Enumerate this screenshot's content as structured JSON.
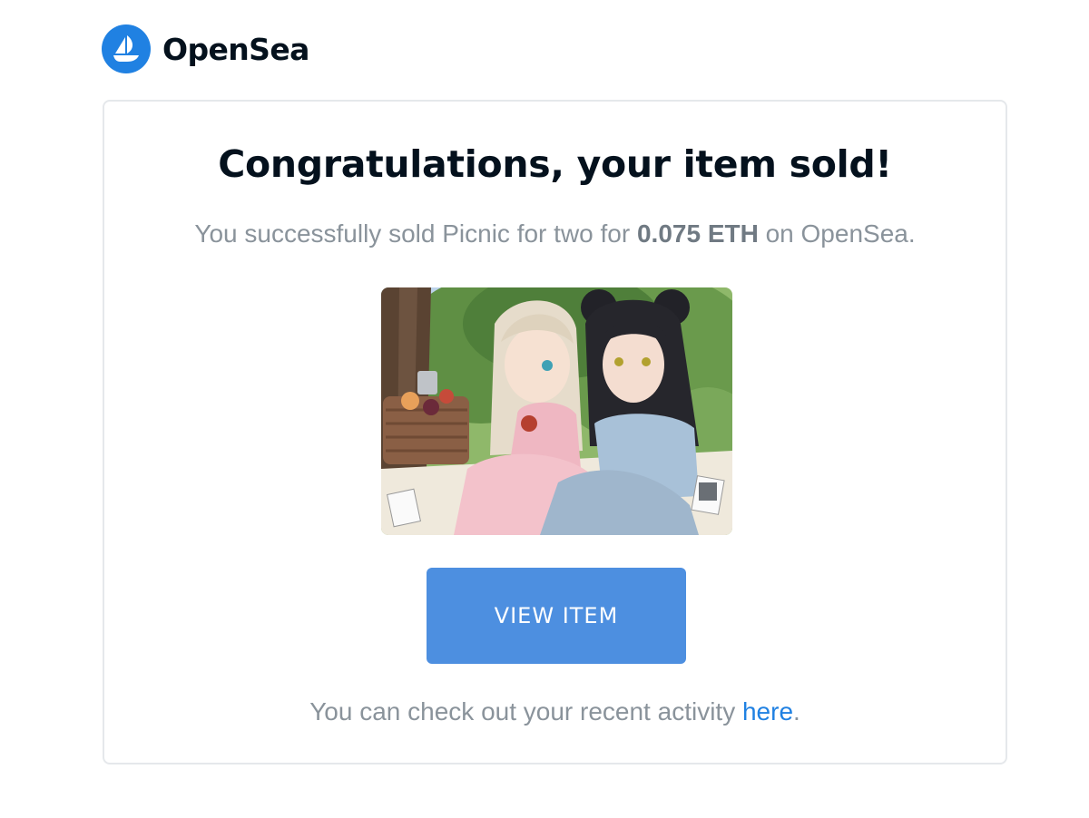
{
  "brand": {
    "name": "OpenSea",
    "logo_icon": "opensea-ship-icon",
    "logo_color": "#2081e2"
  },
  "email": {
    "heading": "Congratulations, your item sold!",
    "sale": {
      "prefix": "You successfully sold ",
      "item_name": "Picnic for two",
      "middle": " for ",
      "price": "0.075 ETH",
      "suffix": " on OpenSea."
    },
    "artwork_alt": "Picnic for two",
    "view_button_label": "VIEW ITEM",
    "button_color": "#4d8fe0",
    "footer": {
      "prefix": "You can check out your recent activity ",
      "link_text": "here",
      "suffix": "."
    }
  }
}
